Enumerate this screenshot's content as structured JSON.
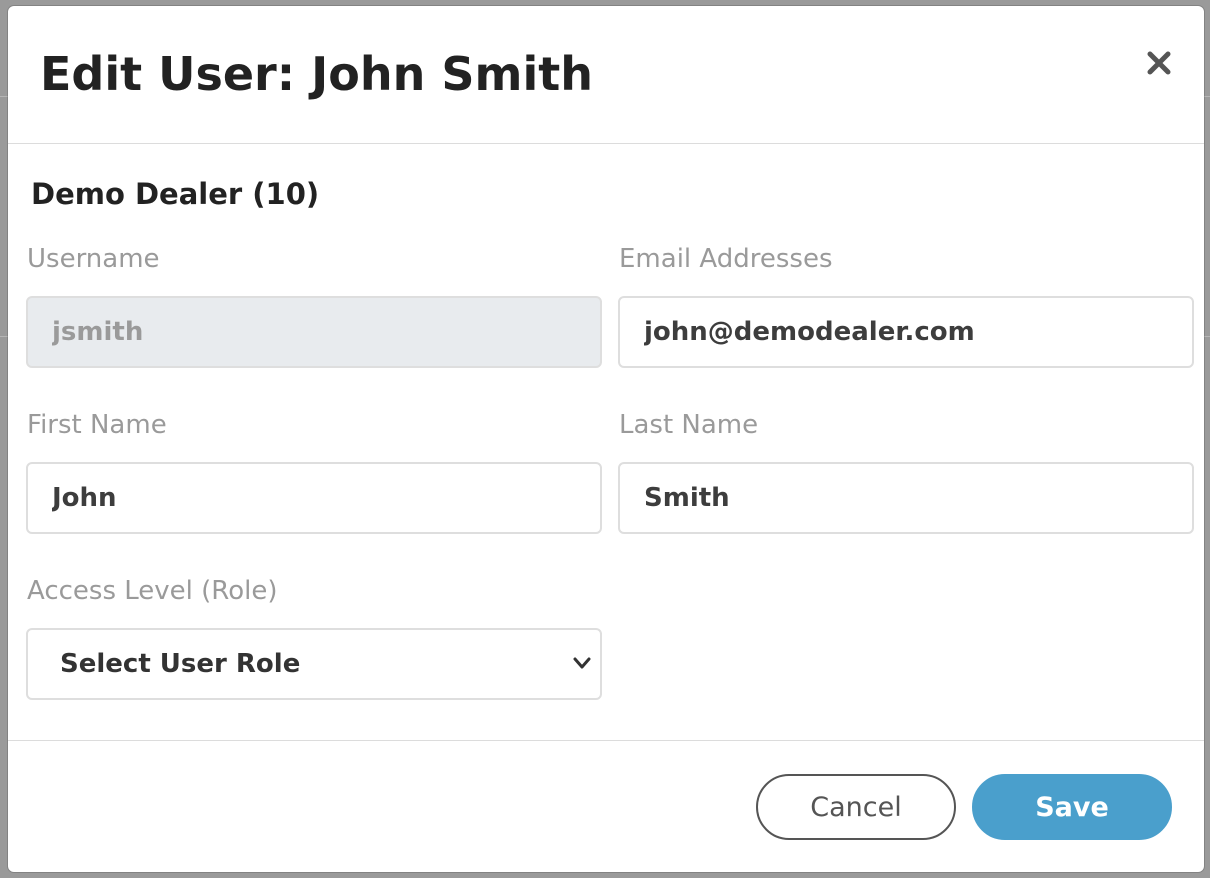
{
  "modal": {
    "title": "Edit User: John Smith",
    "close_icon": "close-icon",
    "section_title": "Demo Dealer (10)"
  },
  "form": {
    "username": {
      "label": "Username",
      "value": "jsmith",
      "readonly": true
    },
    "email": {
      "label": "Email Addresses",
      "value": "john@demodealer.com"
    },
    "first_name": {
      "label": "First Name",
      "value": "John"
    },
    "last_name": {
      "label": "Last Name",
      "value": "Smith"
    },
    "role": {
      "label": "Access Level (Role)",
      "selected": "Select User Role",
      "chevron_icon": "chevron-down-icon"
    }
  },
  "footer": {
    "cancel_label": "Cancel",
    "save_label": "Save"
  },
  "colors": {
    "primary": "#4a9fcc",
    "title_text": "#222222",
    "label_text": "#9a9a9a",
    "readonly_bg": "#e8ebee",
    "overlay": "#9a9a9a"
  }
}
